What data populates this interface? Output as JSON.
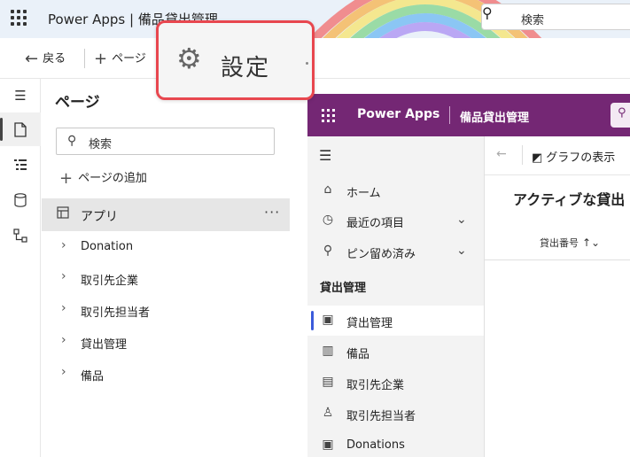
{
  "header": {
    "app_title": "Power Apps | 備品貸出管理",
    "search_placeholder": "検索",
    "waffle_icon": "waffle-icon",
    "search_icon": "search-icon"
  },
  "command_bar": {
    "back_label": "戻る",
    "add_page_label": "ページ"
  },
  "rail": {
    "items": [
      "menu-icon",
      "page-icon",
      "tree-icon",
      "data-icon",
      "flow-icon"
    ]
  },
  "pages_panel": {
    "title": "ページ",
    "search_placeholder": "検索",
    "add_page_label": "ページの追加",
    "app_label": "アプリ",
    "app_more": "···",
    "items": [
      "Donation",
      "取引先企業",
      "取引先担当者",
      "貸出管理",
      "備品"
    ]
  },
  "callout": {
    "label": "設定",
    "icon": "gear-icon",
    "border_color": "#e8474f"
  },
  "preview": {
    "brand_color": "#742774",
    "title": "Power Apps",
    "app_name": "備品貸出管理",
    "nav": {
      "home": "ホーム",
      "recent": "最近の項目",
      "pinned": "ピン留め済み",
      "section": "貸出管理",
      "items": [
        "貸出管理",
        "備品",
        "取引先企業",
        "取引先担当者",
        "Donations"
      ]
    },
    "main": {
      "show_chart": "グラフの表示",
      "view_title": "アクティブな貸出",
      "column_header": "貸出番号"
    }
  }
}
